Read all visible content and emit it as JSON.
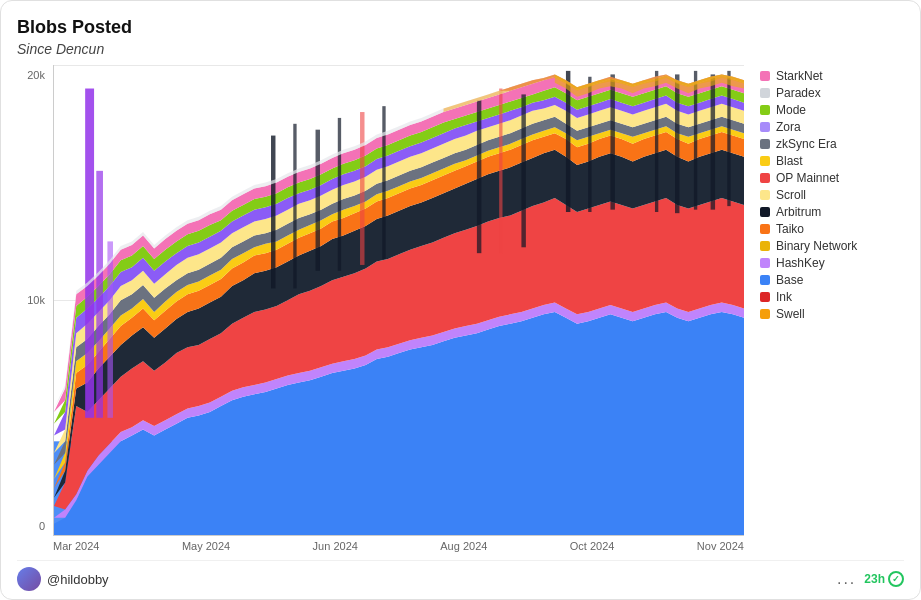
{
  "title": "Blobs Posted",
  "subtitle": "Since Dencun",
  "y_axis": {
    "labels": [
      "20k",
      "10k",
      "0"
    ]
  },
  "x_axis": {
    "labels": [
      "Mar 2024",
      "May 2024",
      "Jun 2024",
      "Aug 2024",
      "Oct 2024",
      "Nov 2024"
    ]
  },
  "legend": [
    {
      "name": "StarkNet",
      "color": "#f472b6"
    },
    {
      "name": "Paradex",
      "color": "#d1d5db"
    },
    {
      "name": "Mode",
      "color": "#84cc16"
    },
    {
      "name": "Zora",
      "color": "#a78bfa"
    },
    {
      "name": "zkSync Era",
      "color": "#6b7280"
    },
    {
      "name": "Blast",
      "color": "#facc15"
    },
    {
      "name": "OP Mainnet",
      "color": "#ef4444"
    },
    {
      "name": "Scroll",
      "color": "#fde68a"
    },
    {
      "name": "Arbitrum",
      "color": "#111827"
    },
    {
      "name": "Taiko",
      "color": "#f97316"
    },
    {
      "name": "Binary Network",
      "color": "#eab308"
    },
    {
      "name": "HashKey",
      "color": "#c084fc"
    },
    {
      "name": "Base",
      "color": "#3b82f6"
    },
    {
      "name": "Ink",
      "color": "#dc2626"
    },
    {
      "name": "Swell",
      "color": "#f59e0b"
    }
  ],
  "footer": {
    "user": "@hildobby",
    "time_label": "23h",
    "dots": "..."
  }
}
